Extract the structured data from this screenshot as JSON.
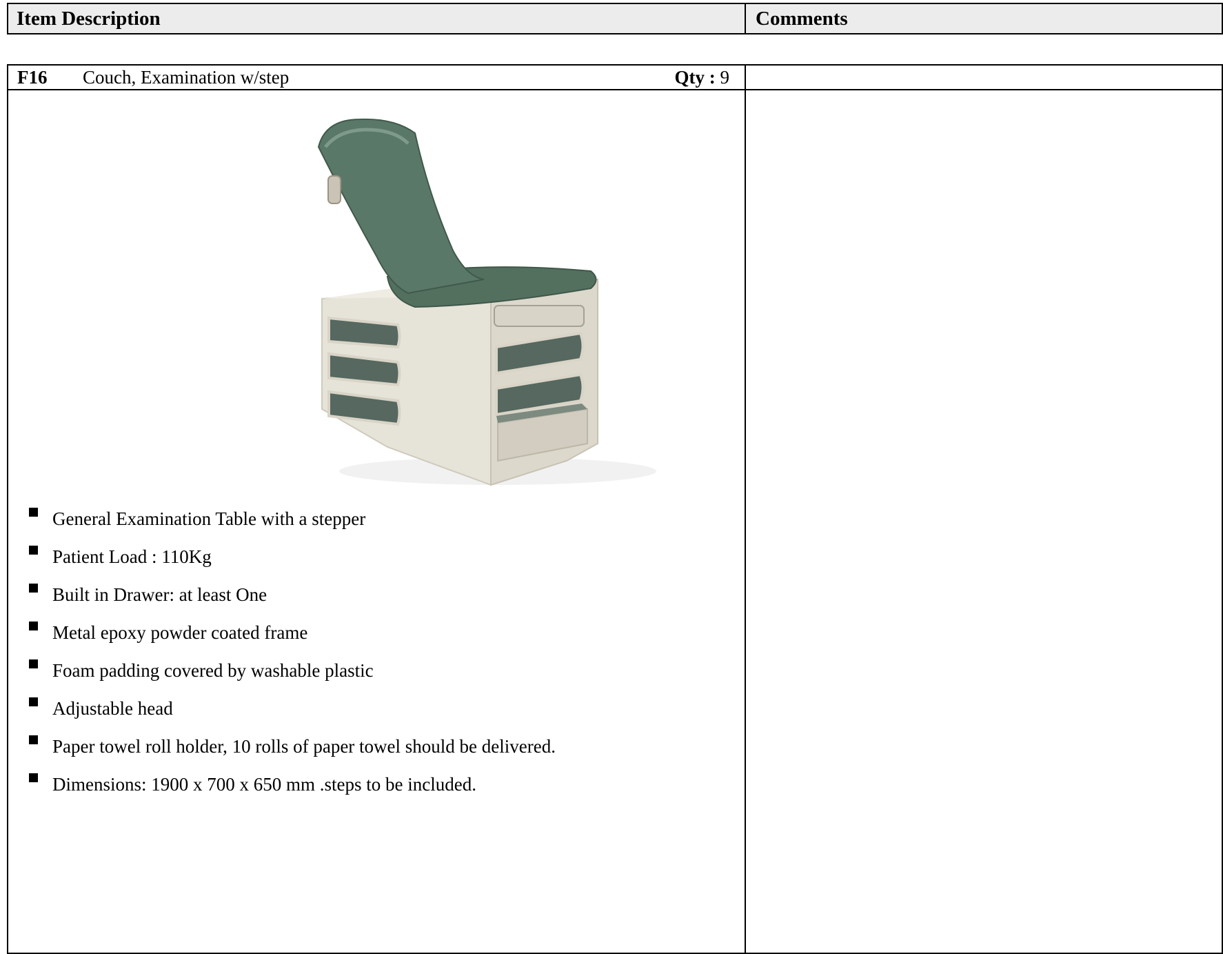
{
  "header": {
    "item_description": "Item Description",
    "comments": "Comments"
  },
  "item": {
    "code": "F16",
    "name": "Couch, Examination w/step",
    "qty_label": "Qty :",
    "qty_value": "9",
    "image_icon": "examination-couch-illustration",
    "features": [
      "General Examination Table with a stepper",
      "Patient Load : 110Kg",
      "Built in Drawer: at least One",
      "Metal epoxy powder coated frame",
      "Foam padding covered by washable plastic",
      "Adjustable head",
      "Paper towel roll holder, 10 rolls of paper towel should be delivered.",
      "Dimensions: 1900 x 700 x 650 mm .steps to be included."
    ],
    "comment": ""
  },
  "colors": {
    "header_bg": "#ececec",
    "upholstery": "#4f6b5e",
    "base": "#e7e4da"
  }
}
